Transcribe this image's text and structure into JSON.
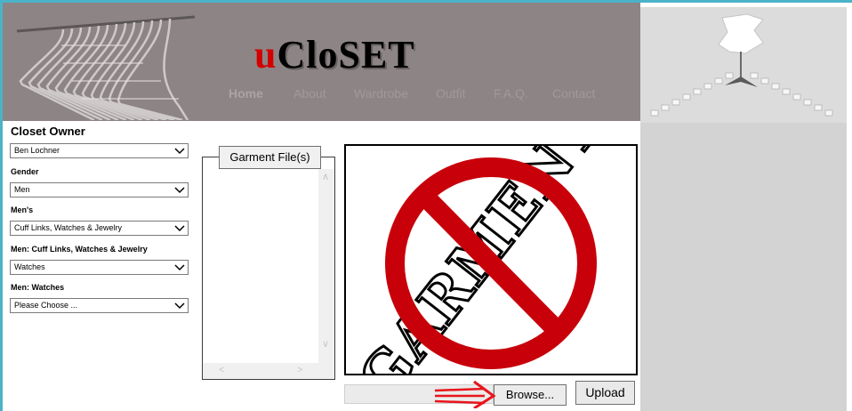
{
  "header": {
    "logo_part1": "u",
    "logo_part2": "CloSET",
    "nav": [
      {
        "label": "Home"
      },
      {
        "label": "About"
      },
      {
        "label": "Wardrobe"
      },
      {
        "label": "Outfit"
      },
      {
        "label": "F.A.Q."
      },
      {
        "label": "Contact"
      }
    ]
  },
  "filters": {
    "owner_label": "Closet Owner",
    "owner_value": "Ben Lochner",
    "gender_label": "Gender",
    "gender_value": "Men",
    "category_label": "Men's",
    "category_value": "Cuff Links, Watches & Jewelry",
    "subcategory_label": "Men: Cuff Links, Watches & Jewelry",
    "subcategory_value": "Watches",
    "item_label": "Men: Watches",
    "item_value": "Please Choose ..."
  },
  "files": {
    "legend": "Garment File(s)"
  },
  "preview": {
    "watermark_text": "GARMENT"
  },
  "upload": {
    "browse_label": "Browse...",
    "upload_label": "Upload"
  },
  "colors": {
    "header_bg": "#8d8585",
    "logo_red": "#d40000",
    "prohibition_red": "#c8000a",
    "annotation_arrow": "#e8151b"
  }
}
